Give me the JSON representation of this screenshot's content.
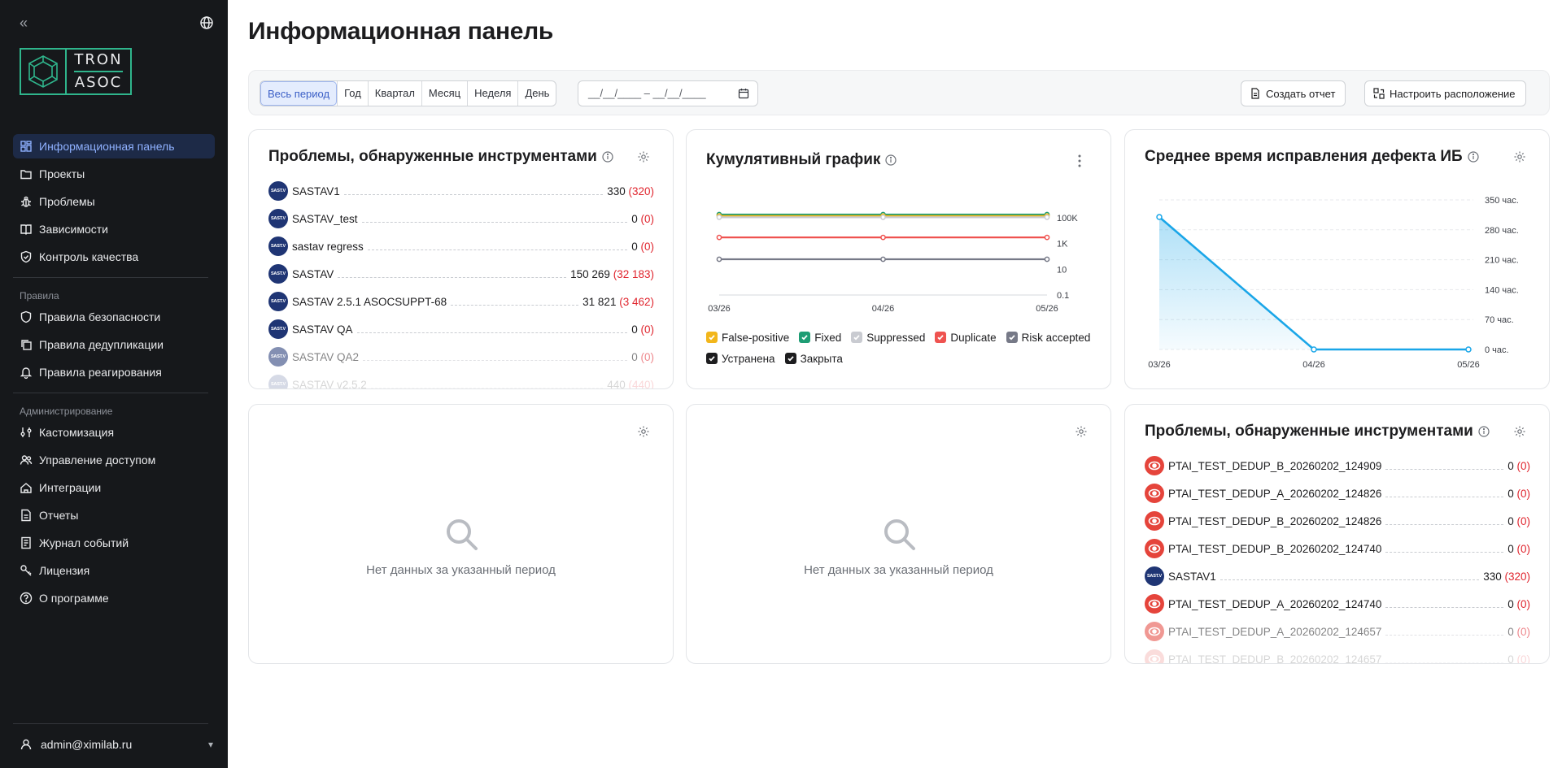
{
  "sidebar": {
    "logo": {
      "line1": "TRON",
      "line2": "ASOC"
    },
    "nav": [
      {
        "label": "Информационная панель",
        "icon": "dashboard-icon",
        "active": true
      },
      {
        "label": "Проекты",
        "icon": "folder-icon"
      },
      {
        "label": "Проблемы",
        "icon": "bug-icon"
      },
      {
        "label": "Зависимости",
        "icon": "book-icon"
      },
      {
        "label": "Контроль качества",
        "icon": "shield-check-icon"
      }
    ],
    "section_rules": "Правила",
    "rules": [
      {
        "label": "Правила безопасности",
        "icon": "shield-icon"
      },
      {
        "label": "Правила дедупликации",
        "icon": "copy-icon"
      },
      {
        "label": "Правила реагирования",
        "icon": "bell-icon"
      }
    ],
    "section_admin": "Администрирование",
    "admin": [
      {
        "label": "Кастомизация",
        "icon": "sliders-icon"
      },
      {
        "label": "Управление доступом",
        "icon": "users-icon"
      },
      {
        "label": "Интеграции",
        "icon": "integration-icon"
      },
      {
        "label": "Отчеты",
        "icon": "report-icon"
      },
      {
        "label": "Журнал событий",
        "icon": "journal-icon"
      },
      {
        "label": "Лицензия",
        "icon": "key-icon"
      },
      {
        "label": "О программе",
        "icon": "help-icon"
      }
    ],
    "user": "admin@ximilab.ru"
  },
  "main": {
    "title": "Информационная панель",
    "periods": [
      "Весь период",
      "Год",
      "Квартал",
      "Месяц",
      "Неделя",
      "День"
    ],
    "date_placeholder": "_._/_.__ – _._/_.__",
    "date_value": "__/__/____ – __/__/____",
    "create_report": "Создать отчет",
    "configure_layout": "Настроить расположение"
  },
  "tools_card": {
    "title": "Проблемы, обнаруженные инструментами",
    "avatar_text": "SAST.V",
    "rows": [
      {
        "name": "SASTAV1",
        "count": "330",
        "extra": "(320)"
      },
      {
        "name": "SASTAV_test",
        "count": "0",
        "extra": "(0)"
      },
      {
        "name": "sastav regress",
        "count": "0",
        "extra": "(0)"
      },
      {
        "name": "SASTAV",
        "count": "150 269",
        "extra": "(32 183)"
      },
      {
        "name": "SASTAV 2.5.1 ASOCSUPPT-68",
        "count": "31 821",
        "extra": "(3 462)"
      },
      {
        "name": "SASTAV QA",
        "count": "0",
        "extra": "(0)"
      },
      {
        "name": "SASTAV QA2",
        "count": "0",
        "extra": "(0)"
      },
      {
        "name": "SASTAV v2.5.2",
        "count": "440",
        "extra": "(440)"
      }
    ]
  },
  "cumulative_card": {
    "title": "Кумулятивный график",
    "legend": [
      {
        "label": "False-positive",
        "color": "#f2b61b"
      },
      {
        "label": "Fixed",
        "color": "#1e9d74"
      },
      {
        "label": "Suppressed",
        "color": "#c9cbd1"
      },
      {
        "label": "Duplicate",
        "color": "#ef5350"
      },
      {
        "label": "Risk accepted",
        "color": "#767987"
      },
      {
        "label": "Устранена",
        "color": "#1d1d1f"
      },
      {
        "label": "Закрыта",
        "color": "#1d1d1f"
      }
    ]
  },
  "mttr_card": {
    "title": "Среднее время исправления дефекта ИБ"
  },
  "empty_cards": {
    "message": "Нет данных за указанный период"
  },
  "tools_card2": {
    "title": "Проблемы, обнаруженные инструментами",
    "avatar_text": "SAST.V",
    "rows": [
      {
        "name": "PTAI_TEST_DEDUP_B_20260202_124909",
        "count": "0",
        "extra": "(0)",
        "kind": "pt"
      },
      {
        "name": "PTAI_TEST_DEDUP_A_20260202_124826",
        "count": "0",
        "extra": "(0)",
        "kind": "pt"
      },
      {
        "name": "PTAI_TEST_DEDUP_B_20260202_124826",
        "count": "0",
        "extra": "(0)",
        "kind": "pt"
      },
      {
        "name": "PTAI_TEST_DEDUP_B_20260202_124740",
        "count": "0",
        "extra": "(0)",
        "kind": "pt"
      },
      {
        "name": "SASTAV1",
        "count": "330",
        "extra": "(320)",
        "kind": "sastav"
      },
      {
        "name": "PTAI_TEST_DEDUP_A_20260202_124740",
        "count": "0",
        "extra": "(0)",
        "kind": "pt"
      },
      {
        "name": "PTAI_TEST_DEDUP_A_20260202_124657",
        "count": "0",
        "extra": "(0)",
        "kind": "pt"
      },
      {
        "name": "PTAI_TEST_DEDUP_B_20260202_124657",
        "count": "0",
        "extra": "(0)",
        "kind": "pt"
      }
    ]
  },
  "chart_data": [
    {
      "type": "line",
      "title": "Кумулятивный график",
      "x": [
        "03/26",
        "04/26",
        "05/26"
      ],
      "y_scale": "log",
      "y_ticks": [
        "0.1",
        "10",
        "1K",
        "100K"
      ],
      "series": [
        {
          "name": "Fixed",
          "color": "#1e9d74",
          "values": [
            180000,
            180000,
            180000
          ]
        },
        {
          "name": "False-positive",
          "color": "#f2b61b",
          "values": [
            140000,
            140000,
            140000
          ]
        },
        {
          "name": "Suppressed",
          "color": "#c9cbd1",
          "values": [
            110000,
            110000,
            110000
          ]
        },
        {
          "name": "Duplicate",
          "color": "#ef5350",
          "values": [
            3000,
            3000,
            3000
          ]
        },
        {
          "name": "Risk accepted",
          "color": "#767987",
          "values": [
            60,
            60,
            60
          ]
        }
      ],
      "grid": false
    },
    {
      "type": "area",
      "title": "Среднее время исправления дефекта ИБ",
      "x": [
        "03/26",
        "04/26",
        "05/26"
      ],
      "y_ticks": [
        "0 час.",
        "70 час.",
        "140 час.",
        "210 час.",
        "280 час.",
        "350 час."
      ],
      "ylim": [
        0,
        350
      ],
      "values": [
        310,
        0,
        0
      ],
      "color": "#1aa6e8",
      "grid": true
    }
  ]
}
